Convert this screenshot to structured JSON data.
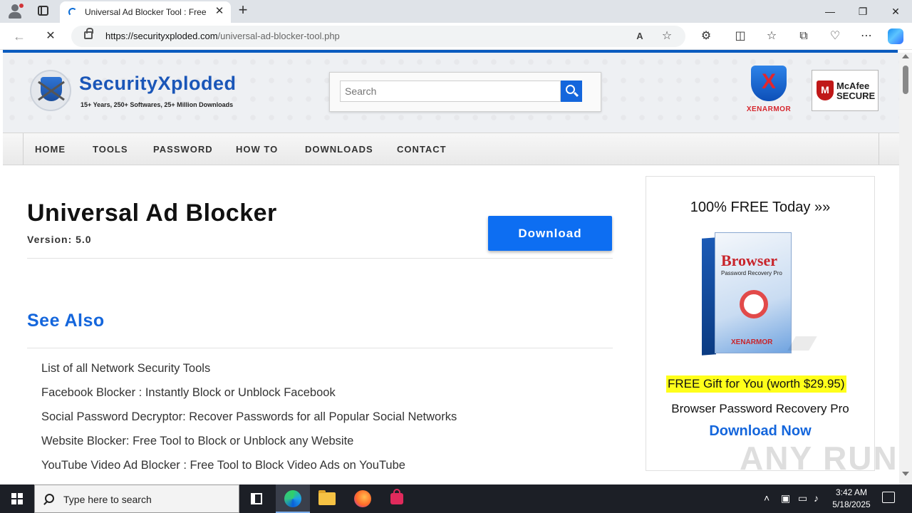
{
  "browser": {
    "tab_title": "Universal Ad Blocker Tool : Free A",
    "new_tab_symbol": "+",
    "url_domain": "https://securityxploded.com",
    "url_path": "/universal-ad-blocker-tool.php",
    "window_controls": [
      "—",
      "❐",
      "✕"
    ]
  },
  "site": {
    "logo_title": "SecurityXploded",
    "logo_subtitle": "15+ Years, 250+ Softwares, 25+ Million Downloads",
    "search_placeholder": "Search",
    "partner1_label": "XENARMOR",
    "partner2_brand": "McAfee",
    "partner2_label": "SECURE",
    "nav": [
      "HOME",
      "TOOLS",
      "PASSWORD",
      "HOW TO",
      "DOWNLOADS",
      "CONTACT"
    ]
  },
  "main": {
    "title": "Universal Ad Blocker",
    "version": "Version: 5.0",
    "download_label": "Download",
    "see_also_heading": "See Also",
    "links": [
      "List of all Network Security Tools",
      "Facebook Blocker : Instantly Block or Unblock Facebook",
      "Social Password Decryptor: Recover Passwords for all Popular Social Networks",
      "Website Blocker: Free Tool to Block or Unblock any Website",
      "YouTube Video Ad Blocker : Free Tool to Block Video Ads on YouTube"
    ]
  },
  "sidebar": {
    "heading": "100% FREE Today  »»",
    "box_title": "Browser",
    "box_subtitle": "Password Recovery Pro",
    "box_brand": "XENARMOR",
    "gift": "FREE Gift for You (worth $29.95)",
    "product": "Browser Password Recovery Pro",
    "cta": "Download Now"
  },
  "watermark": "ANY RUN",
  "taskbar": {
    "search_placeholder": "Type here to search",
    "time": "3:42 AM",
    "date": "5/18/2025"
  },
  "colors": {
    "accent": "#1466dc",
    "download_button": "#0d6ef2",
    "gift_highlight": "#ffff1a"
  }
}
